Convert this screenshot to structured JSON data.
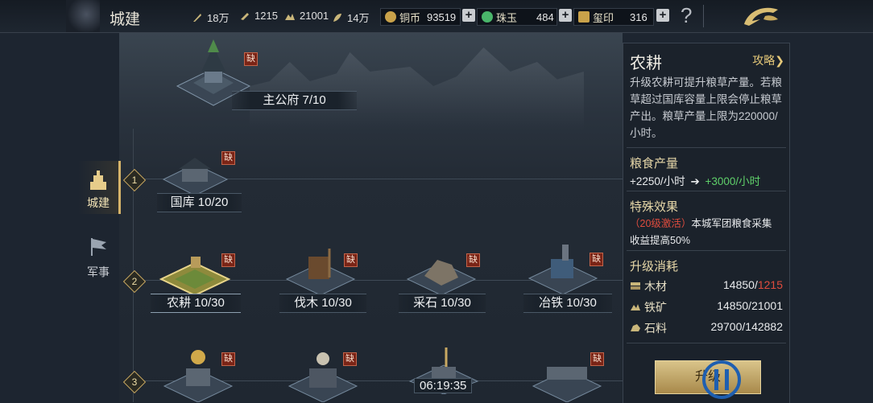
{
  "header": {
    "title": "城建",
    "resources": [
      {
        "icon": "feather-icon",
        "value": "18万"
      },
      {
        "icon": "horn-icon",
        "value": "1215"
      },
      {
        "icon": "ore-icon",
        "value": "21001"
      },
      {
        "icon": "grain-icon",
        "value": "14万"
      }
    ],
    "currencies": [
      {
        "icon": "copper-coin-icon",
        "label": "铜币",
        "value": "93519",
        "color": "#c9a24a"
      },
      {
        "icon": "jade-icon",
        "label": "珠玉",
        "value": "484",
        "color": "#49b56a"
      },
      {
        "icon": "seal-icon",
        "label": "玺印",
        "value": "316",
        "color": "#c9a24a"
      }
    ],
    "plus": "+",
    "help": "?"
  },
  "sidenav": {
    "items": [
      {
        "label": "城建",
        "icon": "tower-icon",
        "active": true
      },
      {
        "label": "军事",
        "icon": "flag-icon",
        "active": false
      }
    ]
  },
  "map": {
    "main_building": {
      "name": "主公府 7/10",
      "lack": "缺"
    },
    "tiers": [
      "1",
      "2",
      "3"
    ],
    "tier1": [
      {
        "name": "国库 10/20",
        "lack": "缺"
      }
    ],
    "tier2": [
      {
        "name": "农耕 10/30",
        "lack": "缺",
        "selected": true
      },
      {
        "name": "伐木 10/30",
        "lack": "缺"
      },
      {
        "name": "采石 10/30",
        "lack": "缺"
      },
      {
        "name": "冶铁 10/30",
        "lack": "缺"
      }
    ],
    "tier3": [
      {
        "lack": "缺"
      },
      {
        "lack": "缺"
      },
      {
        "timer": "06:19:35"
      },
      {
        "lack": "缺"
      }
    ]
  },
  "panel": {
    "title": "农耕",
    "guide": "攻略",
    "description": "升级农耕可提升粮草产量。若粮草超过国库容量上限会停止粮草产出。粮草产量上限为220000/小时。",
    "yield_heading": "粮食产量",
    "yield_current": "+2250/小时",
    "yield_next": "+3000/小时",
    "effect_heading": "特殊效果",
    "effect_activation": "（20级激活）",
    "effect_text_1": "本城军团粮食采集",
    "effect_text_2": "收益提高50%",
    "cost_heading": "升级消耗",
    "costs": [
      {
        "icon": "wood-icon",
        "label": "木材",
        "required": "14850",
        "owned": "1215",
        "insufficient": true
      },
      {
        "icon": "iron-icon",
        "label": "铁矿",
        "required": "14850",
        "owned": "21001",
        "insufficient": false
      },
      {
        "icon": "stone-icon",
        "label": "石料",
        "required": "29700",
        "owned": "142882",
        "insufficient": false
      }
    ],
    "upgrade_button": "升级"
  }
}
